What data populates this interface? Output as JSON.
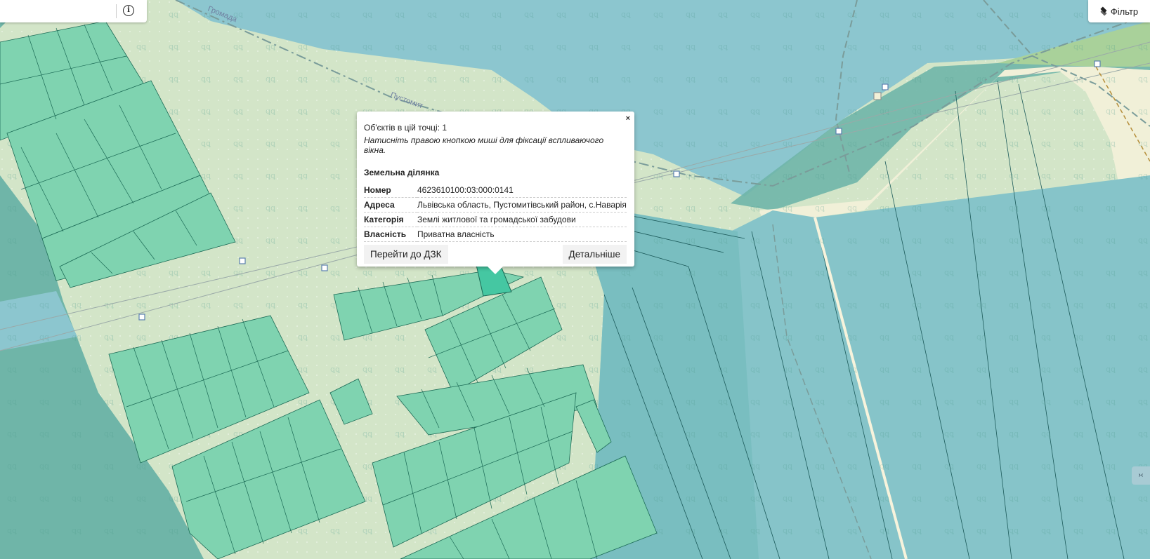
{
  "search": {
    "placeholder": "",
    "info_icon": "info-circle-icon"
  },
  "filter": {
    "label": "Фільтр",
    "icon": "layers-icon"
  },
  "map": {
    "street_labels": [
      "Громада",
      "Пустомит"
    ],
    "colors": {
      "background": "#d3e5c8",
      "forest": "#6fb5a8",
      "water": "#8cc6cf",
      "parcel": "#7fd3b0",
      "parcel_selected": "#45c7a2",
      "big_field": "#86c4c9",
      "meadow": "#a9d19a",
      "cream": "#f1f0d8"
    }
  },
  "popup": {
    "close_label": "×",
    "count_text": "Об'єктів в цій точці: 1",
    "hint_text": "Натисніть правою кнопкою миші для фіксації вспливаючого вікна.",
    "section_title": "Земельна ділянка",
    "fields": [
      {
        "key": "Номер",
        "value": "4623610100:03:000:0141"
      },
      {
        "key": "Адреса",
        "value": "Львівська область, Пустомитівський район, с.Наварія"
      },
      {
        "key": "Категорія",
        "value": "Землі житлової та громадської забудови"
      },
      {
        "key": "Власність",
        "value": "Приватна власність"
      }
    ],
    "button_dzk": "Перейти до ДЗК",
    "button_details": "Детальніше"
  },
  "side_control": {
    "label": "›‹"
  }
}
